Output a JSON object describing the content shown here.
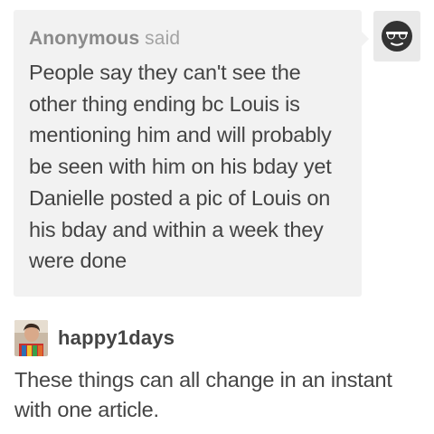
{
  "ask": {
    "asker_name": "Anonymous",
    "said_label": " said",
    "question_text": "People say they can't see the other thing ending bc Louis is mentioning him and will probably be seen with him on his bday yet Danielle posted a pic of Louis on his bday and within a week they were done",
    "avatar_icon": "anonymous-sunglasses-icon"
  },
  "reply": {
    "username": "happy1days",
    "avatar_icon": "user-avatar",
    "text": "These things can all change in an instant with one article."
  },
  "colors": {
    "bubble_background": "#f2f2f2",
    "asker_name": "#8a8a8a",
    "body_text": "#444444",
    "anon_avatar_background": "#e9e9e9",
    "anon_icon": "#333333"
  }
}
